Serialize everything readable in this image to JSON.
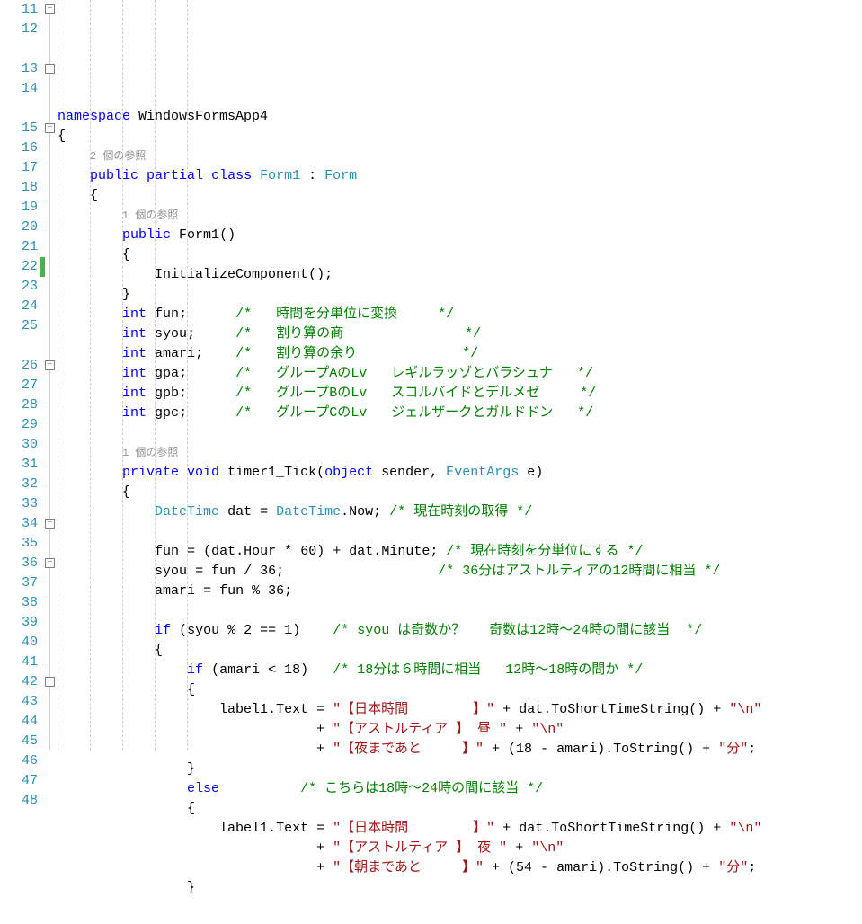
{
  "lines": [
    {
      "n": 11,
      "fold": "minus",
      "html": [
        "kw:namespace",
        " ",
        "id:WindowsFormsApp4"
      ]
    },
    {
      "n": 12,
      "html": [
        "pn:{"
      ]
    },
    {
      "lens": "2 個の参照",
      "indent": "    "
    },
    {
      "n": 13,
      "fold": "minus",
      "html": [
        "    ",
        "kw:public",
        " ",
        "kw:partial",
        " ",
        "kw:class",
        " ",
        "type:Form1",
        " ",
        "pn::",
        " ",
        "type:Form"
      ]
    },
    {
      "n": 14,
      "html": [
        "    ",
        "pn:{"
      ]
    },
    {
      "lens": "1 個の参照",
      "indent": "        "
    },
    {
      "n": 15,
      "fold": "minus",
      "html": [
        "        ",
        "kw:public",
        " ",
        "id:Form1",
        "pn:()"
      ]
    },
    {
      "n": 16,
      "html": [
        "        ",
        "pn:{"
      ]
    },
    {
      "n": 17,
      "html": [
        "            ",
        "id:InitializeComponent",
        "pn:();"
      ]
    },
    {
      "n": 18,
      "html": [
        "        ",
        "pn:}"
      ]
    },
    {
      "n": 19,
      "html": [
        "        ",
        "kw:int",
        " ",
        "id:fun",
        "pn:;",
        "      ",
        "cm:/*   時間を分単位に変換     */"
      ]
    },
    {
      "n": 20,
      "html": [
        "        ",
        "kw:int",
        " ",
        "id:syou",
        "pn:;",
        "     ",
        "cm:/*   割り算の商               */"
      ]
    },
    {
      "n": 21,
      "html": [
        "        ",
        "kw:int",
        " ",
        "id:amari",
        "pn:;",
        "    ",
        "cm:/*   割り算の余り             */"
      ]
    },
    {
      "n": 22,
      "change": true,
      "html": [
        "        ",
        "kw:int",
        " ",
        "id:gpa",
        "pn:;",
        "      ",
        "cm:/*   グループAのLv   レギルラッゾとバラシュナ   */"
      ]
    },
    {
      "n": 23,
      "html": [
        "        ",
        "kw:int",
        " ",
        "id:gpb",
        "pn:;",
        "      ",
        "cm:/*   グループBのLv   スコルバイドとデルメゼ     */"
      ]
    },
    {
      "n": 24,
      "html": [
        "        ",
        "kw:int",
        " ",
        "id:gpc",
        "pn:;",
        "      ",
        "cm:/*   グループCのLv   ジェルザークとガルドドン   */"
      ]
    },
    {
      "n": 25,
      "html": [
        ""
      ]
    },
    {
      "lens": "1 個の参照",
      "indent": "        "
    },
    {
      "n": 26,
      "fold": "minus",
      "html": [
        "        ",
        "kw:private",
        " ",
        "kw:void",
        " ",
        "id:timer1_Tick",
        "pn:(",
        "kw:object",
        " ",
        "id:sender",
        "pn:,",
        " ",
        "type:EventArgs",
        " ",
        "id:e",
        "pn:)"
      ]
    },
    {
      "n": 27,
      "html": [
        "        ",
        "pn:{"
      ]
    },
    {
      "n": 28,
      "html": [
        "            ",
        "type:DateTime",
        " ",
        "id:dat",
        " ",
        "pn:=",
        " ",
        "type:DateTime",
        "pn:.",
        "id:Now",
        "pn:;",
        " ",
        "cm:/* 現在時刻の取得 */"
      ]
    },
    {
      "n": 29,
      "html": [
        ""
      ]
    },
    {
      "n": 30,
      "html": [
        "            ",
        "id:fun",
        " ",
        "pn:=",
        " ",
        "pn:(",
        "id:dat",
        "pn:.",
        "id:Hour",
        " ",
        "pn:*",
        " ",
        "num:60",
        "pn:)",
        " ",
        "pn:+",
        " ",
        "id:dat",
        "pn:.",
        "id:Minute",
        "pn:;",
        " ",
        "cm:/* 現在時刻を分単位にする */"
      ]
    },
    {
      "n": 31,
      "html": [
        "            ",
        "id:syou",
        " ",
        "pn:=",
        " ",
        "id:fun",
        " ",
        "pn:/",
        " ",
        "num:36",
        "pn:;",
        "                   ",
        "cm:/* 36分はアストルティアの12時間に相当 */"
      ]
    },
    {
      "n": 32,
      "html": [
        "            ",
        "id:amari",
        " ",
        "pn:=",
        " ",
        "id:fun",
        " ",
        "pn:%",
        " ",
        "num:36",
        "pn:;"
      ]
    },
    {
      "n": 33,
      "html": [
        ""
      ]
    },
    {
      "n": 34,
      "fold": "minus",
      "html": [
        "            ",
        "kw:if",
        " ",
        "pn:(",
        "id:syou",
        " ",
        "pn:%",
        " ",
        "num:2",
        " ",
        "pn:==",
        " ",
        "num:1",
        "pn:)",
        "    ",
        "cm:/* syou は奇数か？   奇数は12時～24時の間に該当  */"
      ]
    },
    {
      "n": 35,
      "html": [
        "            ",
        "pn:{"
      ]
    },
    {
      "n": 36,
      "fold": "minus",
      "html": [
        "                ",
        "kw:if",
        " ",
        "pn:(",
        "id:amari",
        " ",
        "pn:<",
        " ",
        "num:18",
        "pn:)",
        "   ",
        "cm:/* 18分は６時間に相当   12時～18時の間か */"
      ]
    },
    {
      "n": 37,
      "html": [
        "                ",
        "pn:{"
      ]
    },
    {
      "n": 38,
      "html": [
        "                    ",
        "id:label1",
        "pn:.",
        "id:Text",
        " ",
        "pn:=",
        " ",
        "str:\"【日本時間        】\"",
        " ",
        "pn:+",
        " ",
        "id:dat",
        "pn:.",
        "id:ToShortTimeString",
        "pn:()",
        " ",
        "pn:+",
        " ",
        "str:\"\\n\""
      ]
    },
    {
      "n": 39,
      "html": [
        "                                ",
        "pn:+",
        " ",
        "str:\"【アストルティア 】 昼 \"",
        " ",
        "pn:+",
        " ",
        "str:\"\\n\""
      ]
    },
    {
      "n": 40,
      "html": [
        "                                ",
        "pn:+",
        " ",
        "str:\"【夜まであと     】\"",
        " ",
        "pn:+",
        " ",
        "pn:(",
        "num:18",
        " ",
        "pn:-",
        " ",
        "id:amari",
        "pn:).",
        "id:ToString",
        "pn:()",
        " ",
        "pn:+",
        " ",
        "str:\"分\"",
        "pn:;"
      ]
    },
    {
      "n": 41,
      "html": [
        "                ",
        "pn:}"
      ]
    },
    {
      "n": 42,
      "fold": "minus",
      "html": [
        "                ",
        "kw:else",
        "          ",
        "cm:/* こちらは18時～24時の間に該当 */"
      ]
    },
    {
      "n": 43,
      "html": [
        "                ",
        "pn:{"
      ]
    },
    {
      "n": 44,
      "html": [
        "                    ",
        "id:label1",
        "pn:.",
        "id:Text",
        " ",
        "pn:=",
        " ",
        "str:\"【日本時間        】\"",
        " ",
        "pn:+",
        " ",
        "id:dat",
        "pn:.",
        "id:ToShortTimeString",
        "pn:()",
        " ",
        "pn:+",
        " ",
        "str:\"\\n\""
      ]
    },
    {
      "n": 45,
      "html": [
        "                                ",
        "pn:+",
        " ",
        "str:\"【アストルティア 】 夜 \"",
        " ",
        "pn:+",
        " ",
        "str:\"\\n\""
      ]
    },
    {
      "n": 46,
      "html": [
        "                                ",
        "pn:+",
        " ",
        "str:\"【朝まであと     】\"",
        " ",
        "pn:+",
        " ",
        "pn:(",
        "num:54",
        " ",
        "pn:-",
        " ",
        "id:amari",
        "pn:).",
        "id:ToString",
        "pn:()",
        " ",
        "pn:+",
        " ",
        "str:\"分\"",
        "pn:;"
      ]
    },
    {
      "n": 47,
      "html": [
        "                ",
        "pn:}"
      ]
    },
    {
      "n": 48,
      "html": [
        ""
      ]
    }
  ]
}
